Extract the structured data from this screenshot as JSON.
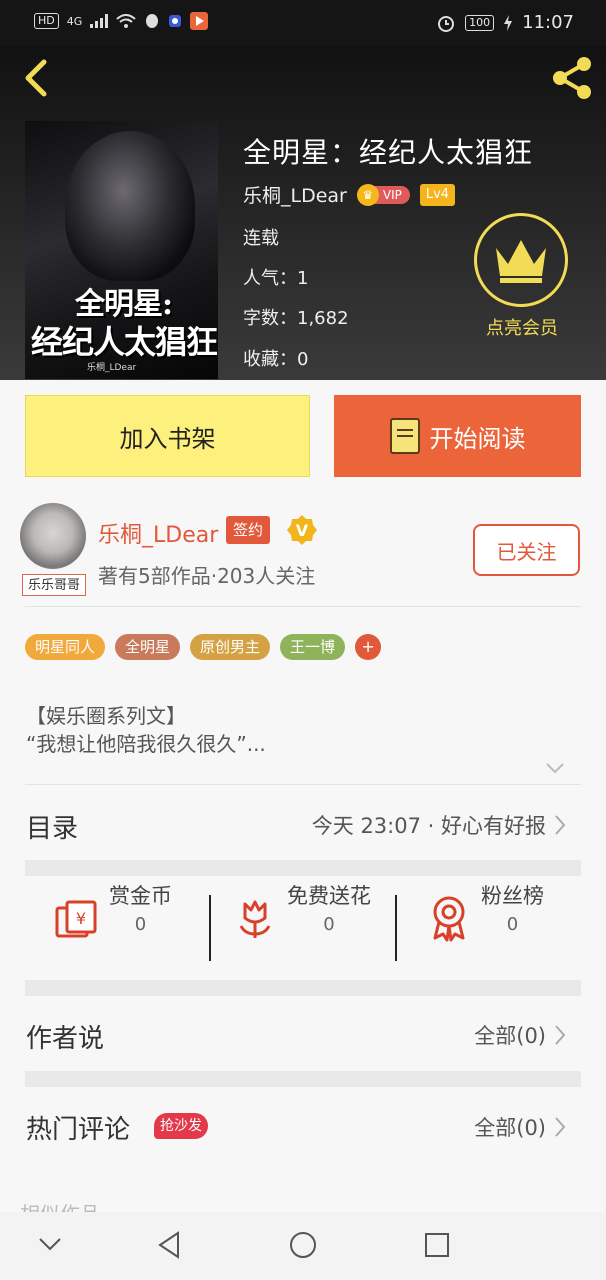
{
  "status_bar": {
    "left_chip": "HD",
    "network": "4G",
    "battery": "100",
    "time": "11:07"
  },
  "book": {
    "title": "全明星：经纪人太猖狂",
    "cover_title_line1": "全明星:",
    "cover_title_line2": "经纪人太猖狂",
    "cover_author": "乐桐_LDear",
    "author": "乐桐_LDear",
    "vip_label": "VIP",
    "level": "Lv4",
    "status": "连载",
    "popularity": "人气：1",
    "word_count": "字数：1,682",
    "favorites": "收藏：0"
  },
  "member": {
    "label": "点亮会员"
  },
  "actions": {
    "add_shelf": "加入书架",
    "start_reading": "开始阅读"
  },
  "author_card": {
    "avatar_tag": "乐乐哥哥",
    "name": "乐桐_LDear",
    "signed": "签约",
    "v_badge": "V",
    "stats": "著有5部作品·203人关注",
    "follow": "已关注"
  },
  "tags": [
    {
      "label": "明星同人",
      "color": "#f0a93a"
    },
    {
      "label": "全明星",
      "color": "#c97a5b"
    },
    {
      "label": "原创男主",
      "color": "#d4a143"
    },
    {
      "label": "王一博",
      "color": "#8fb35a"
    }
  ],
  "tag_more": "+",
  "description": {
    "line1": "【娱乐圈系列文】",
    "line2": "“我想让他陪我很久很久”..."
  },
  "toc": {
    "label": "目录",
    "latest": "今天 23:07 · 好心有好报"
  },
  "rewards": [
    {
      "label": "赏金币",
      "count": "0"
    },
    {
      "label": "免费送花",
      "count": "0"
    },
    {
      "label": "粉丝榜",
      "count": "0"
    }
  ],
  "author_says": {
    "label": "作者说",
    "all": "全部(0)"
  },
  "hot_comments": {
    "label": "热门评论",
    "badge": "抢沙发",
    "all": "全部(0)"
  },
  "similar": {
    "label": "相似作品"
  },
  "colors": {
    "accent": "#e2583a",
    "yellow": "#fdf07c",
    "gold": "#f3dc55"
  }
}
